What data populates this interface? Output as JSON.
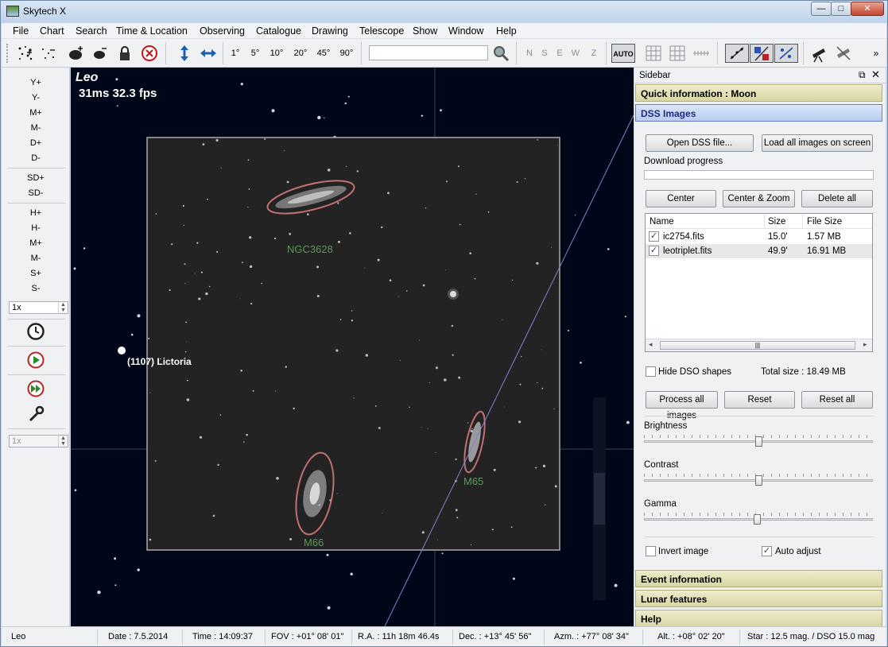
{
  "window": {
    "title": "Skytech X",
    "min": "—",
    "max": "□",
    "close": "✕"
  },
  "menu": [
    "File",
    "Chart",
    "Search",
    "Time & Location",
    "Observing",
    "Catalogue",
    "Drawing",
    "Telescope",
    "Show",
    "Window",
    "Help"
  ],
  "toolbar": {
    "fov_buttons": [
      "1°",
      "5°",
      "10°",
      "20°",
      "45°",
      "90°"
    ],
    "search_value": "",
    "directions": [
      "N",
      "S",
      "E",
      "W",
      "Z"
    ],
    "auto_label": "AUTO"
  },
  "leftbar": {
    "group1": [
      "Y+",
      "Y-",
      "M+",
      "M-",
      "D+",
      "D-"
    ],
    "group2": [
      "SD+",
      "SD-"
    ],
    "group3": [
      "H+",
      "H-",
      "M+",
      "M-",
      "S+",
      "S-"
    ],
    "speed": "1x",
    "speed2": "1x"
  },
  "chart": {
    "constellation": "Leo",
    "fps": "31ms 32.3 fps",
    "asteroid": "(1107) Lictoria",
    "labels": {
      "ngc": "NGC3628",
      "m65": "M65",
      "m66": "M66"
    }
  },
  "sidebar": {
    "title": "Sidebar",
    "quick_info": "Quick information : Moon",
    "dss": "DSS Images",
    "open_btn": "Open DSS file...",
    "load_btn": "Load all images on screen",
    "progress_label": "Download progress",
    "progress": 0,
    "center_btn": "Center",
    "center_zoom_btn": "Center & Zoom",
    "delete_btn": "Delete all",
    "table_headers": [
      "Name",
      "Size",
      "File Size"
    ],
    "files": [
      {
        "name": "ic2754.fits",
        "size": "15.0'",
        "filesize": "1.57 MB",
        "checked": true
      },
      {
        "name": "leotriplet.fits",
        "size": "49.9'",
        "filesize": "16.91 MB",
        "checked": true
      }
    ],
    "hide_dso": "Hide DSO shapes",
    "hide_dso_checked": false,
    "total_size": "Total size : 18.49 MB",
    "process_btn": "Process all images",
    "reset_btn": "Reset",
    "reset_all_btn": "Reset all",
    "brightness_label": "Brightness",
    "brightness": 0.5,
    "contrast_label": "Contrast",
    "contrast": 0.5,
    "gamma_label": "Gamma",
    "gamma": 0.495,
    "invert_label": "Invert image",
    "invert_checked": false,
    "auto_adjust_label": "Auto adjust",
    "auto_adjust_checked": true,
    "event_info": "Event information",
    "lunar": "Lunar features",
    "help": "Help"
  },
  "status": {
    "constellation": "Leo",
    "date": "Date : 7.5.2014",
    "time": "Time : 14:09:37",
    "fov": "FOV : +01° 08' 01\"",
    "ra": "R.A. : 11h 18m 46.4s",
    "dec": "Dec. : +13° 45' 56\"",
    "azm": "Azm. : +77° 08' 34\"",
    "alt": "Alt. : +08° 02' 20\"",
    "star": "Star : 12.5 mag. / DSO 15.0 mag"
  },
  "colors": {
    "sky": "#000718",
    "label_green": "#5a9a5a",
    "ellipse": "#c07070",
    "header": "#d9d6a4",
    "active_header": "#c7d8f5"
  }
}
